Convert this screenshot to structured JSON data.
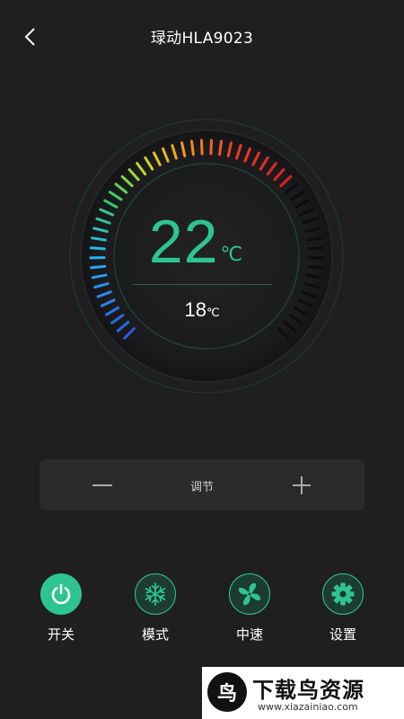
{
  "header": {
    "title": "琭动HLA9023"
  },
  "dial": {
    "set_temp": "22",
    "set_unit": "℃",
    "current_temp": "18",
    "current_unit": "℃",
    "level_fraction": 0.68,
    "accent": "#2ec492"
  },
  "adjust": {
    "label": "调节",
    "minus": "—",
    "plus": "+"
  },
  "controls": [
    {
      "label": "开关",
      "icon": "power-icon",
      "active": true
    },
    {
      "label": "模式",
      "icon": "snowflake-icon",
      "active": false
    },
    {
      "label": "中速",
      "icon": "fan-icon",
      "active": false
    },
    {
      "label": "设置",
      "icon": "gear-icon",
      "active": false
    }
  ],
  "watermark": {
    "title": "下载鸟资源",
    "url": "www.xiazainiao.com"
  }
}
